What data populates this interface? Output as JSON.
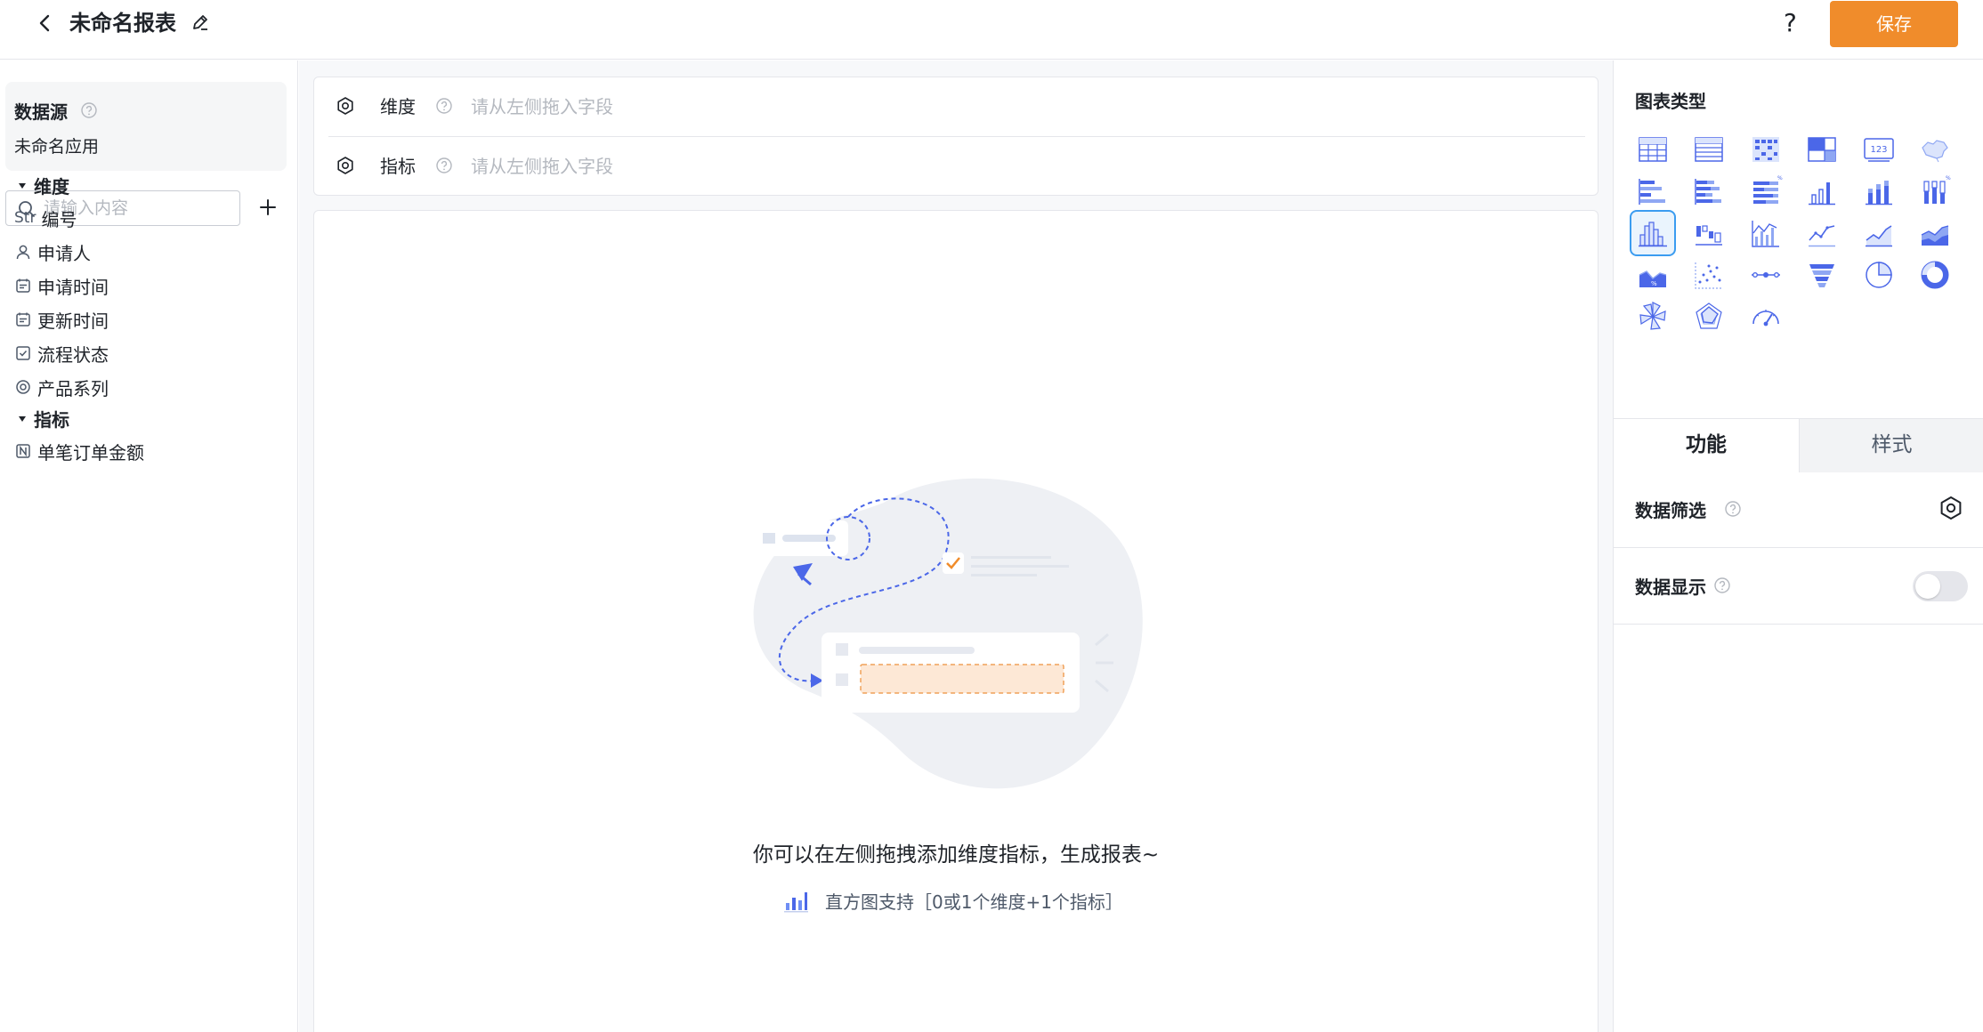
{
  "header": {
    "title": "未命名报表",
    "help_label": "?",
    "save_label": "保存",
    "accent_color": "#f08c2b"
  },
  "left": {
    "datasource_title": "数据源",
    "datasource_app": "未命名应用",
    "search_placeholder": "请输入内容",
    "dimension_group": "维度",
    "dimensions": [
      {
        "icon": "text-type-icon",
        "type_label": "Str",
        "label": "编号"
      },
      {
        "icon": "user-icon",
        "label": "申请人"
      },
      {
        "icon": "calendar-icon",
        "label": "申请时间"
      },
      {
        "icon": "calendar-icon",
        "label": "更新时间"
      },
      {
        "icon": "checkbox-icon",
        "label": "流程状态"
      },
      {
        "icon": "radio-icon",
        "label": "产品系列"
      }
    ],
    "metric_group": "指标",
    "metrics": [
      {
        "icon": "number-type-icon",
        "label": "单笔订单金额"
      }
    ]
  },
  "center": {
    "dimension_label": "维度",
    "dimension_placeholder": "请从左侧拖入字段",
    "metric_label": "指标",
    "metric_placeholder": "请从左侧拖入字段",
    "empty_hint": "你可以在左侧拖拽添加维度指标，生成报表~",
    "chart_support": "直方图支持［0或1个维度+1个指标］"
  },
  "right": {
    "chart_type_title": "图表类型",
    "chart_types": [
      "table-icon",
      "detail-table-icon",
      "pivot-table-icon",
      "cross-table-icon",
      "indicator-card-icon",
      "map-icon",
      "bar-horizontal-icon",
      "stacked-bar-horizontal-icon",
      "percent-bar-horizontal-icon",
      "column-icon",
      "stacked-column-icon",
      "percent-column-icon",
      "histogram-icon",
      "waterfall-icon",
      "combo-icon",
      "line-icon",
      "area-icon",
      "stacked-area-icon",
      "percent-area-icon",
      "scatter-icon",
      "timeline-icon",
      "funnel-icon",
      "pie-icon",
      "donut-icon",
      "rose-icon",
      "radar-icon",
      "gauge-icon"
    ],
    "selected_chart": "histogram-icon",
    "tabs": [
      "功能",
      "样式"
    ],
    "active_tab": "功能",
    "data_filter_label": "数据筛选",
    "data_display_label": "数据显示",
    "data_display_enabled": false
  }
}
